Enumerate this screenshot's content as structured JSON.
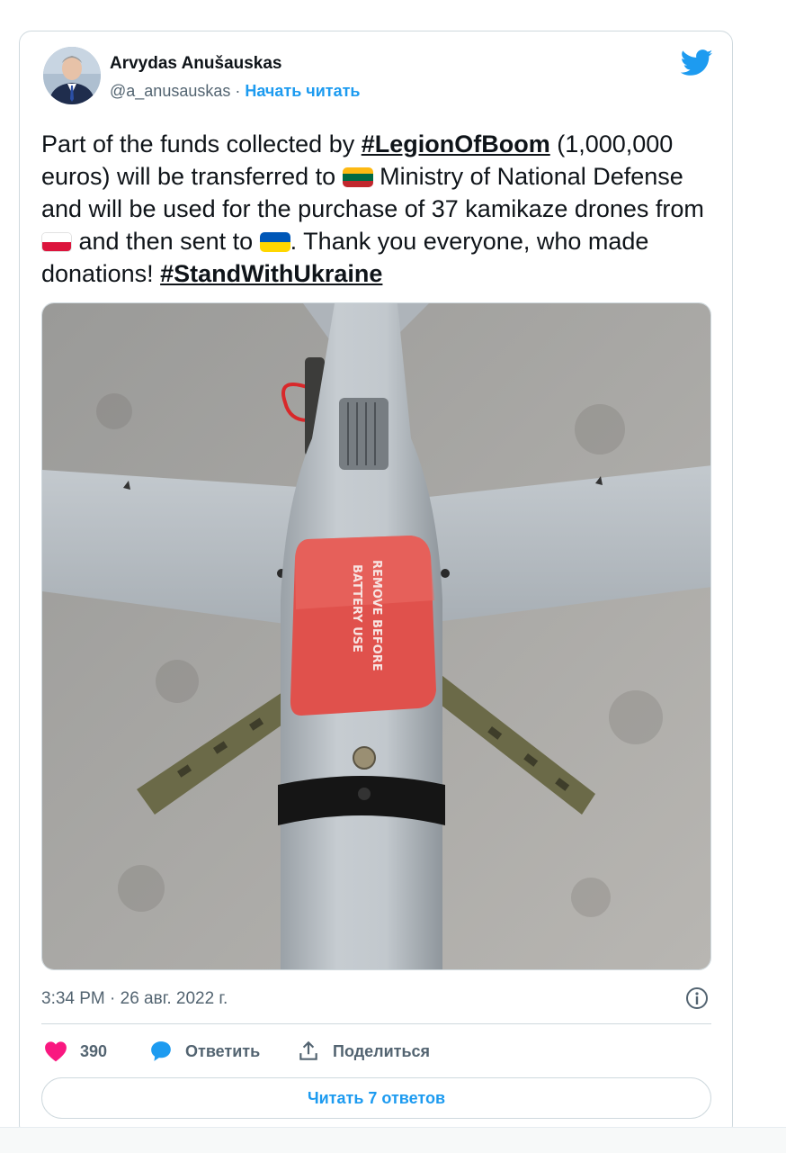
{
  "tweet": {
    "author_name": "Arvydas Anušauskas",
    "author_handle": "@a_anusauskas",
    "separator": " · ",
    "follow_label": "Начать читать",
    "text_parts": {
      "p1": "Part of the funds collected by ",
      "tag1": "#LegionOfBoom",
      "p2": " (1,000,000 euros) will be transferred to ",
      "p3": " Ministry of National Defense and will be used for the purchase of 37 kamikaze drones from ",
      "p4": " and then sent to ",
      "p5": ". Thank you everyone, who made donations! ",
      "tag2": "#StandWithUkraine"
    },
    "flags": {
      "lithuania": [
        "#fdb913",
        "#006a44",
        "#c1272d"
      ],
      "poland": [
        "#ffffff",
        "#dc143c"
      ],
      "ukraine": [
        "#0057b7",
        "#ffd700"
      ]
    },
    "image_label_line1": "REMOVE BEFORE",
    "image_label_line2": "BATTERY USE",
    "timestamp": "3:34 PM · 26 авг. 2022 г.",
    "likes_count": "390",
    "reply_label": "Ответить",
    "share_label": "Поделиться",
    "read_replies_label": "Читать 7 ответов"
  },
  "colors": {
    "accent": "#1d9bf0",
    "like": "#f91880",
    "text": "#0f1419",
    "muted": "#536471"
  },
  "icons": [
    "twitter-bird-icon",
    "info-icon",
    "heart-icon",
    "reply-bubble-icon",
    "share-icon"
  ]
}
